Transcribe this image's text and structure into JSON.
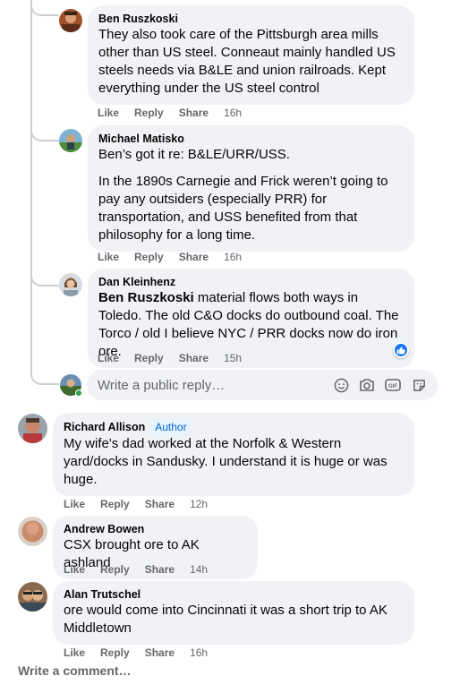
{
  "comments": [
    {
      "author": "Ben Ruszkoski",
      "paragraphs": [
        "They also took care of the Pittsburgh area mills other than US steel. Conneaut mainly handled US steels needs via B&LE and union railroads. Kept everything under the US steel control"
      ],
      "like": "Like",
      "reply": "Reply",
      "share": "Share",
      "time": "16h"
    },
    {
      "author": "Michael Matisko",
      "paragraphs": [
        "Ben’s got it re: B&LE/URR/USS.",
        "In the 1890s Carnegie and Frick weren’t going to pay any outsiders (especially PRR) for transportation, and USS benefited from that philosophy for a long time."
      ],
      "like": "Like",
      "reply": "Reply",
      "share": "Share",
      "time": "16h"
    },
    {
      "author": "Dan Kleinhenz",
      "mention": "Ben Ruszkoski",
      "text": " material flows both ways in Toledo. The old C&O docks do outbound coal. The Torco / old I believe NYC / PRR docks now do iron ore.",
      "like": "Like",
      "reply": "Reply",
      "share": "Share",
      "time": "15h",
      "reaction_icon": "like-reaction-icon"
    },
    {
      "author": "Richard Allison",
      "badge": "Author",
      "text": "My wife's dad worked at the Norfolk & Western yard/docks in Sandusky. I understand it is huge or was huge.",
      "like": "Like",
      "reply": "Reply",
      "share": "Share",
      "time": "12h"
    },
    {
      "author": "Andrew Bowen",
      "text": "CSX brought ore to AK ashland",
      "like": "Like",
      "reply": "Reply",
      "share": "Share",
      "time": "14h"
    },
    {
      "author": "Alan Trutschel",
      "text": "ore would come into Cincinnati it was a short trip to AK Middletown",
      "like": "Like",
      "reply": "Reply",
      "share": "Share",
      "time": "16h"
    }
  ],
  "reply_box": {
    "placeholder": "Write a public reply…",
    "icons": [
      "emoji-icon",
      "camera-icon",
      "gif-icon",
      "sticker-icon"
    ]
  },
  "footer": {
    "write_comment": "Write a comment…"
  },
  "colors": {
    "bubble": "#f0f2f5",
    "secondary_text": "#65676b",
    "accent": "#1877f2",
    "online": "#31a24c"
  }
}
